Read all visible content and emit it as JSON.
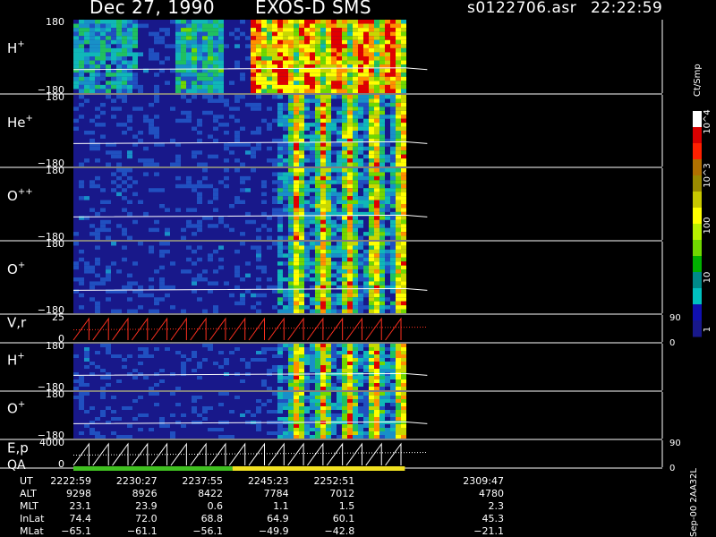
{
  "header": {
    "title": "Dec 27, 1990",
    "instrument": "EXOS-D SMS",
    "file": "s0122706.asr",
    "time": "22:22:59"
  },
  "colorbar": {
    "units": "Ct/Smp",
    "ticks": [
      "10^4",
      "10^3",
      "100",
      "10",
      "1"
    ],
    "colors": [
      "#ffffff",
      "#d80000",
      "#ff2000",
      "#b07000",
      "#9a8a00",
      "#c8c800",
      "#ffff00",
      "#b8f000",
      "#70d800",
      "#00b000",
      "#008a8a",
      "#00c0c0",
      "#1010b0",
      "#18188a"
    ]
  },
  "footer": {
    "stamp": "Sep-00  2AA32L"
  },
  "chart_data": {
    "type": "heatmap",
    "panels": [
      {
        "label": "H",
        "sup": "+",
        "top_tick": "180",
        "bottom_tick": "−180"
      },
      {
        "label": "He",
        "sup": "+",
        "top_tick": "180",
        "bottom_tick": "−180"
      },
      {
        "label": "O",
        "sup": "++",
        "top_tick": "180",
        "bottom_tick": "−180"
      },
      {
        "label": "O",
        "sup": "+",
        "top_tick": "180",
        "bottom_tick": "−180"
      },
      {
        "label": "V,r",
        "sup": "",
        "top_tick": "25",
        "bottom_tick": "0",
        "right_top": "90",
        "right_bottom": "0"
      },
      {
        "label": "H",
        "sup": "+",
        "top_tick": "180",
        "bottom_tick": "−180"
      },
      {
        "label": "O",
        "sup": "+",
        "top_tick": "180",
        "bottom_tick": "−180"
      },
      {
        "label": "E,p",
        "sup": "",
        "top_tick": "4000",
        "bottom_tick": "0",
        "right_top": "90",
        "right_bottom": "0"
      }
    ],
    "qa_label": "QA",
    "orbit_table": {
      "row_labels": [
        "UT",
        "ALT",
        "MLT",
        "InLat",
        "MLat"
      ],
      "columns": [
        [
          "2222:59",
          "9298",
          "23.1",
          "74.4",
          "−65.1"
        ],
        [
          "2230:27",
          "8926",
          "23.9",
          "72.0",
          "−61.1"
        ],
        [
          "2237:55",
          "8422",
          "0.6",
          "68.8",
          "−56.1"
        ],
        [
          "2245:23",
          "7784",
          "1.1",
          "64.9",
          "−49.9"
        ],
        [
          "2252:51",
          "7012",
          "1.5",
          "60.1",
          "−42.8"
        ],
        [
          "2309:47",
          "4780",
          "2.3",
          "45.3",
          "−21.1"
        ]
      ]
    },
    "ut_start_min": 0,
    "ut_data_end_min": 37.6,
    "ut_end_min": 66.8,
    "sawtooth_cycles": 17
  }
}
